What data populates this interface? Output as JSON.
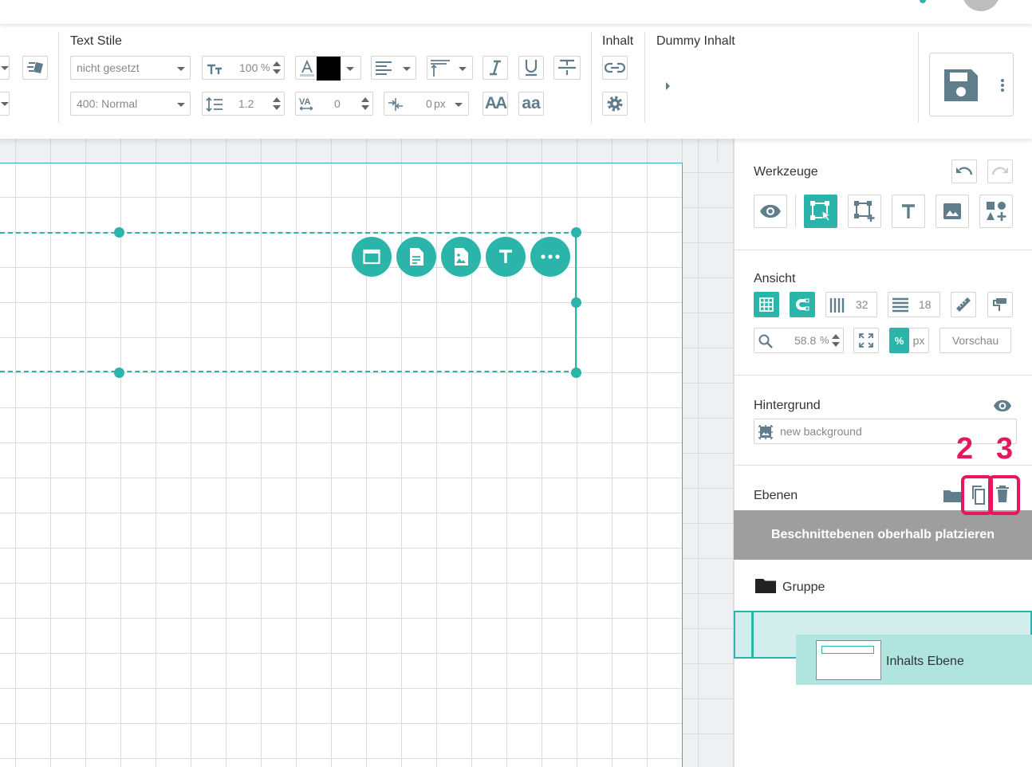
{
  "toolbar": {
    "text_styles_title": "Text Stile",
    "style_select": "nicht gesetzt",
    "font_size": "100",
    "font_size_unit": "%",
    "font_weight_select": "400: Normal",
    "line_height": "1.2",
    "letter_spacing": "0",
    "indent_value": "0",
    "indent_unit": "px",
    "text_color": "#000000",
    "content_title": "Inhalt",
    "dummy_content_title": "Dummy Inhalt",
    "case_upper_label": "AA",
    "case_lower_label": "aa"
  },
  "panel": {
    "tools_title": "Werkzeuge",
    "view_title": "Ansicht",
    "columns_count": "32",
    "rows_count": "18",
    "zoom_value": "58.8",
    "zoom_unit": "%",
    "unit_percent": "%",
    "unit_px": "px",
    "preview_label": "Vorschau",
    "background_title": "Hintergrund",
    "background_placeholder": "new background",
    "layers_title": "Ebenen",
    "clip_banner": "Beschnittebenen oberhalb platzieren",
    "group_label": "Gruppe",
    "layer_label": "Inhalts Ebene"
  },
  "annotations": {
    "callout_2": "2",
    "callout_3": "3"
  },
  "colors": {
    "accent": "#2bb5aa",
    "highlight": "#e8175d",
    "banner": "#9e9e9e",
    "selected_layer_bg": "#d2efed"
  }
}
